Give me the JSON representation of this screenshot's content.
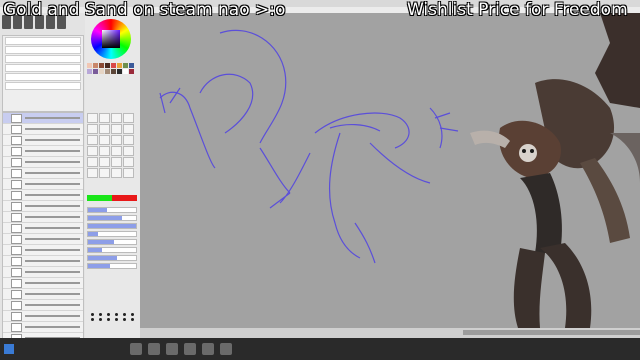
{
  "stream_overlay": {
    "left_text": "Gold and Sand on steam nao >:o",
    "right_text": "Wishlist Price for Freedom"
  },
  "colors": {
    "foreground": "#19e619",
    "background": "#e81818",
    "selected_layer": "#c8cdf0",
    "line_art": "#5b4fd9"
  },
  "icons": [
    "color-wheel-icon",
    "brush-icon",
    "eraser-icon",
    "windows-start-icon"
  ]
}
